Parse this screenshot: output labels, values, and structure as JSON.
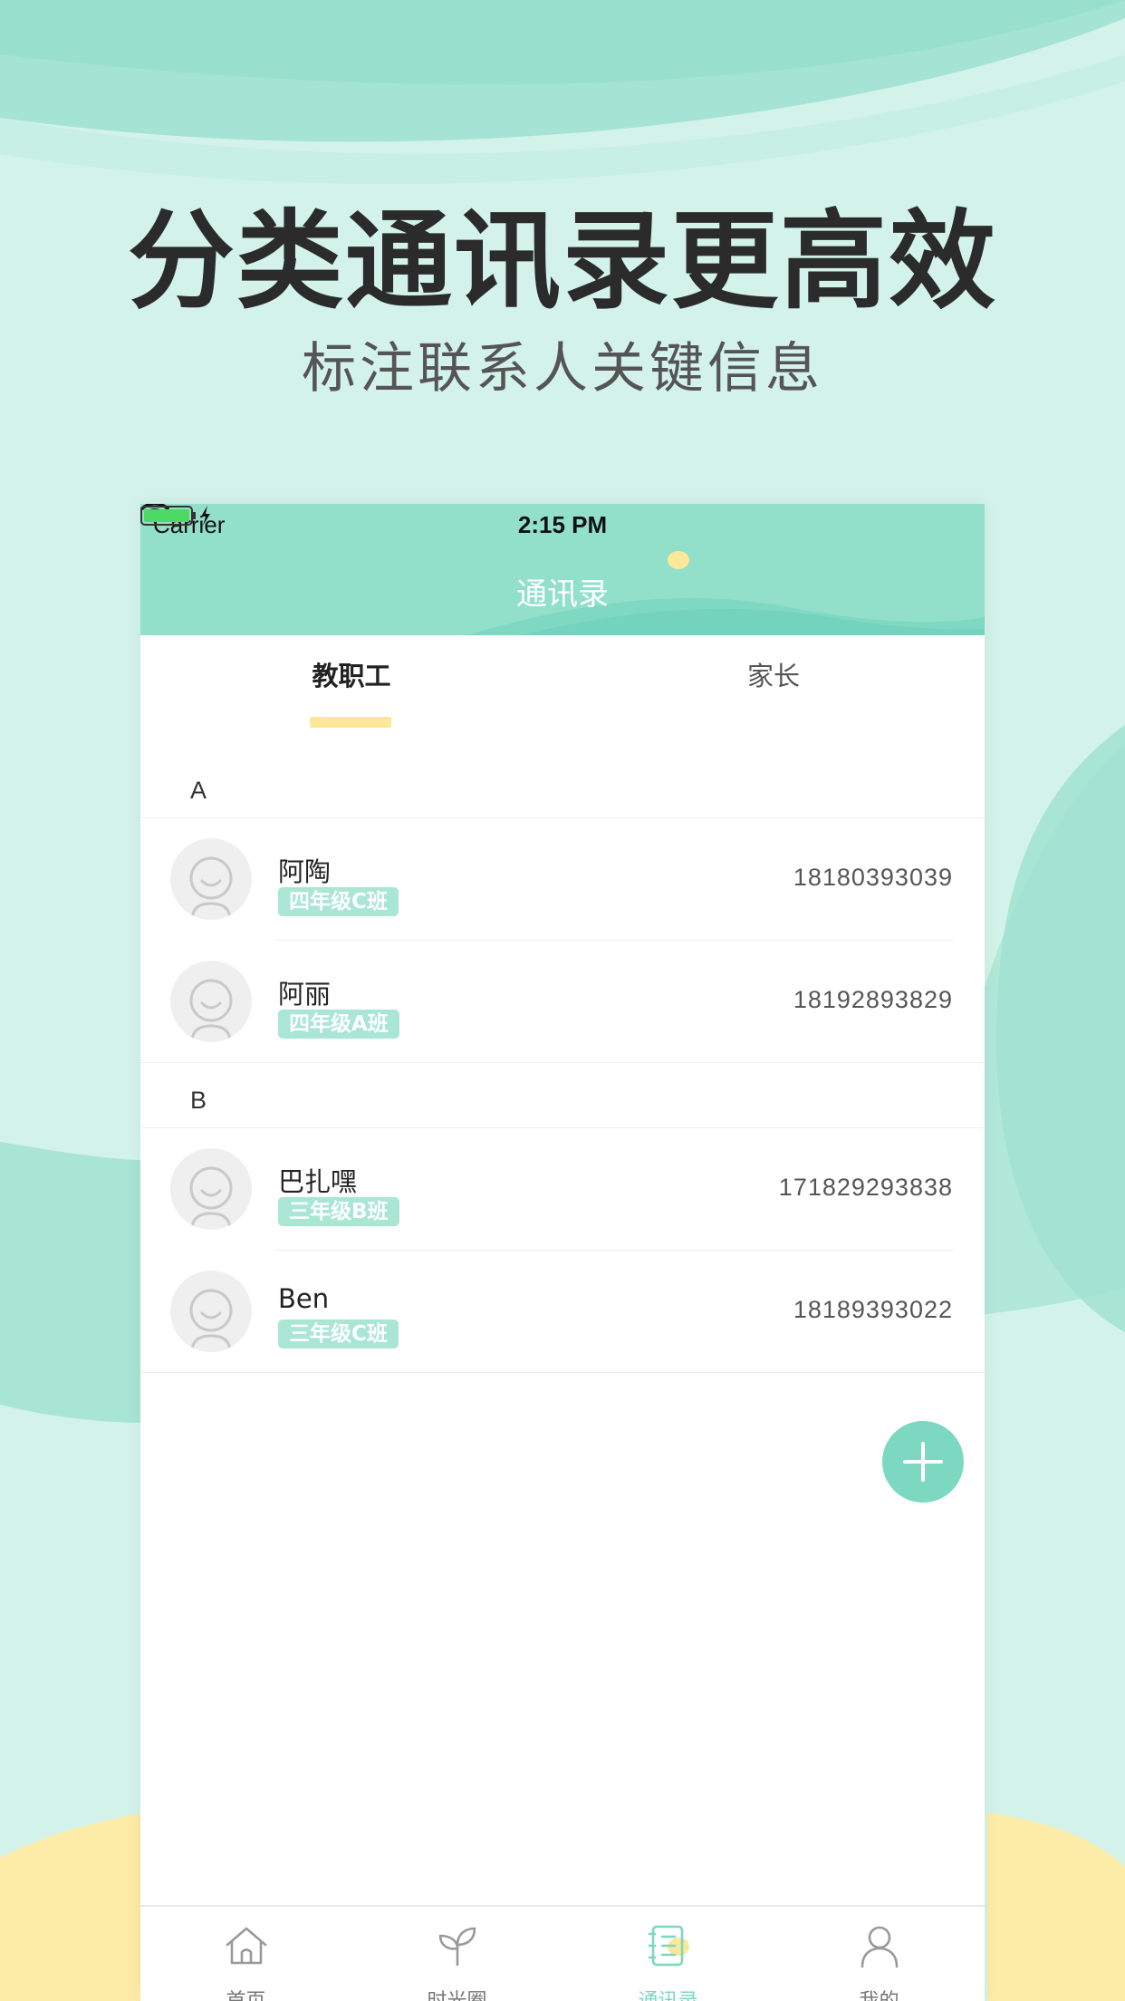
{
  "promo": {
    "title": "分类通讯录更高效",
    "subtitle": "标注联系人关键信息"
  },
  "status_bar": {
    "carrier": "Carrier",
    "time": "2:15 PM"
  },
  "nav": {
    "title": "通讯录"
  },
  "tabs": [
    {
      "label": "教职工",
      "active": true
    },
    {
      "label": "家长",
      "active": false
    }
  ],
  "sections": [
    {
      "letter": "A",
      "contacts": [
        {
          "name": "阿陶",
          "class": "四年级C班",
          "phone": "18180393039"
        },
        {
          "name": "阿丽",
          "class": "四年级A班",
          "phone": "18192893829"
        }
      ]
    },
    {
      "letter": "B",
      "contacts": [
        {
          "name": "巴扎嘿",
          "class": "三年级B班",
          "phone": "171829293838"
        },
        {
          "name": "Ben",
          "class": "三年级C班",
          "phone": "18189393022"
        }
      ]
    }
  ],
  "tab_bar": [
    {
      "label": "首页",
      "icon": "home-icon",
      "active": false
    },
    {
      "label": "时光圈",
      "icon": "sprout-icon",
      "active": false
    },
    {
      "label": "通讯录",
      "icon": "contacts-book-icon",
      "active": true
    },
    {
      "label": "我的",
      "icon": "user-icon",
      "active": false
    }
  ],
  "colors": {
    "accent": "#7cd8c0",
    "header": "#92e0c9",
    "tab_indicator": "#fde89a",
    "badge": "#a9e6d4",
    "background": "#d3f3ea"
  }
}
